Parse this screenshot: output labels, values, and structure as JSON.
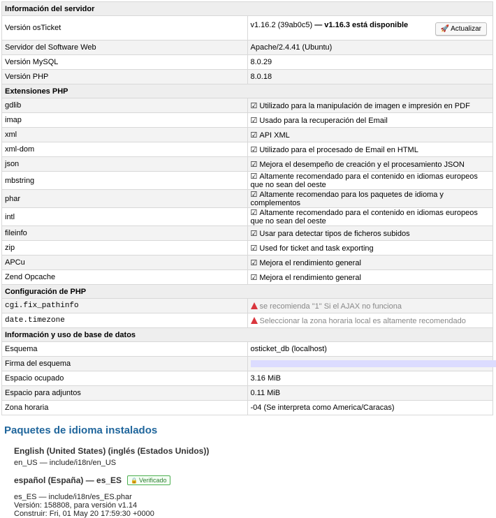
{
  "server": {
    "heading": "Información del servidor",
    "rows": [
      {
        "label": "Versión osTicket",
        "value": "v1.16.2 (39ab0c5)",
        "extra": " — v1.16.3 está disponible",
        "button": "Actualizar"
      },
      {
        "label": "Servidor del Software Web",
        "value": "Apache/2.4.41 (Ubuntu)"
      },
      {
        "label": "Versión MySQL",
        "value": "8.0.29"
      },
      {
        "label": "Versión PHP",
        "value": "8.0.18"
      }
    ]
  },
  "extensions": {
    "heading": "Extensiones PHP",
    "rows": [
      {
        "name": "gdlib",
        "desc": "Utilizado para la manipulación de imagen e impresión en PDF"
      },
      {
        "name": "imap",
        "desc": "Usado para la recuperación del Email"
      },
      {
        "name": "xml",
        "desc": "API XML"
      },
      {
        "name": "xml-dom",
        "desc": "Utilizado para el procesado de Email en HTML"
      },
      {
        "name": "json",
        "desc": "Mejora el desempeño de creación y el procesamiento JSON"
      },
      {
        "name": "mbstring",
        "desc": "Altamente recomendado para el contenido en idiomas europeos que no sean del oeste"
      },
      {
        "name": "phar",
        "desc": "Altamente recomendao para los paquetes de idioma y complementos"
      },
      {
        "name": "intl",
        "desc": "Altamente recomendado para el contenido en idiomas europeos que no sean del oeste"
      },
      {
        "name": "fileinfo",
        "desc": "Usar para detectar tipos de ficheros subidos"
      },
      {
        "name": "zip",
        "desc": "Used for ticket and task exporting"
      },
      {
        "name": "APCu",
        "desc": "Mejora el rendimiento general"
      },
      {
        "name": "Zend Opcache",
        "desc": "Mejora el rendimiento general"
      }
    ]
  },
  "phpconfig": {
    "heading": "Configuración de PHP",
    "rows": [
      {
        "name": "cgi.fix_pathinfo",
        "desc": "se recomienda \"1\" Si el AJAX no funciona"
      },
      {
        "name": "date.timezone",
        "desc": "Seleccionar la zona horaria local es altamente recomendado"
      }
    ]
  },
  "database": {
    "heading": "Información y uso de base de datos",
    "rows": [
      {
        "label": "Esquema",
        "value": "osticket_db (localhost)"
      },
      {
        "label": "Firma del esquema",
        "value": ""
      },
      {
        "label": "Espacio ocupado",
        "value": "3.16 MiB"
      },
      {
        "label": "Espacio para adjuntos",
        "value": "0.11 MiB"
      },
      {
        "label": "Zona horaria",
        "value": "-04 (Se interpreta como America/Caracas)"
      }
    ]
  },
  "languages": {
    "heading": "Paquetes de idioma instalados",
    "packs": [
      {
        "name": "English (United States) (inglés (Estados Unidos))",
        "path": "en_US — include/i18n/en_US"
      },
      {
        "name": "español (España) — es_ES",
        "badge": "Verificado",
        "path": "es_ES — include/i18n/es_ES.phar",
        "version": "Versión: 158808, para versión v1.14",
        "build": "Construir: Fri, 01 May 20 17:59:30 +0000"
      }
    ]
  },
  "colors": {
    "accent_heading": "#20669c",
    "warning": "#d9363e",
    "verified": "#4caf50"
  }
}
